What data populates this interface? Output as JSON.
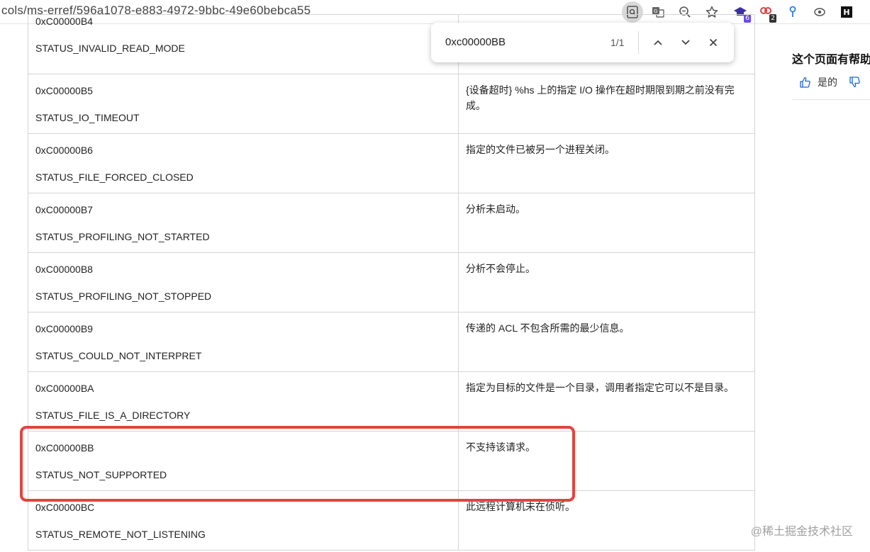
{
  "browser": {
    "url": "cols/ms-erref/596a1078-e883-4972-9bbc-49e60bebca55",
    "extension_badges": [
      "6",
      "2"
    ]
  },
  "find_bar": {
    "query": "0xc00000BB",
    "count": "1/1"
  },
  "table": {
    "rows": [
      {
        "code": "0xC00000B4",
        "name": "STATUS_INVALID_READ_MODE",
        "description": ""
      },
      {
        "code": "0xC00000B5",
        "name": "STATUS_IO_TIMEOUT",
        "description": "{设备超时} %hs 上的指定 I/O 操作在超时期限到期之前没有完成。"
      },
      {
        "code": "0xC00000B6",
        "name": "STATUS_FILE_FORCED_CLOSED",
        "description": "指定的文件已被另一个进程关闭。"
      },
      {
        "code": "0xC00000B7",
        "name": "STATUS_PROFILING_NOT_STARTED",
        "description": "分析未启动。"
      },
      {
        "code": "0xC00000B8",
        "name": "STATUS_PROFILING_NOT_STOPPED",
        "description": "分析不会停止。"
      },
      {
        "code": "0xC00000B9",
        "name": "STATUS_COULD_NOT_INTERPRET",
        "description": "传递的 ACL 不包含所需的最少信息。"
      },
      {
        "code": "0xC00000BA",
        "name": "STATUS_FILE_IS_A_DIRECTORY",
        "description": "指定为目标的文件是一个目录，调用者指定它可以不是目录。"
      },
      {
        "code": "0xC00000BB",
        "name": "STATUS_NOT_SUPPORTED",
        "description": "不支持该请求。"
      },
      {
        "code": "0xC00000BC",
        "name": "STATUS_REMOTE_NOT_LISTENING",
        "description": "此远程计算机未在侦听。"
      }
    ]
  },
  "feedback": {
    "title": "这个页面有帮助",
    "yes_label": "是的"
  },
  "watermark": "@稀土掘金技术社区",
  "colors": {
    "highlight": "#e0453f",
    "border": "#d5d5d5"
  }
}
